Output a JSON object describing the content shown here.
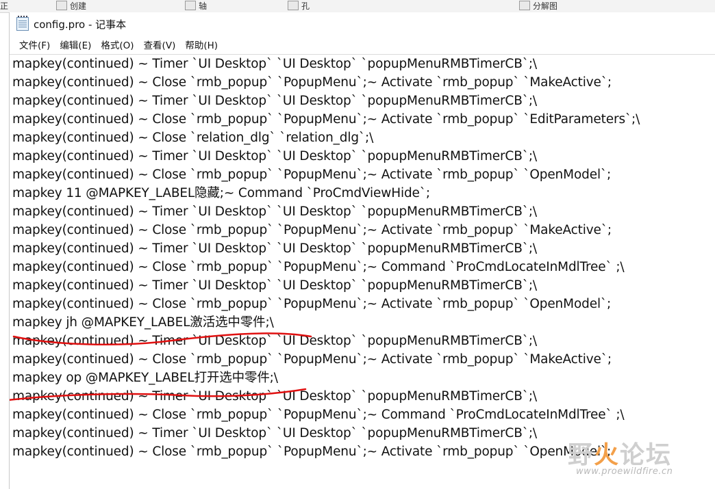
{
  "background_app": {
    "items": [
      "正",
      "创建",
      "轴",
      "孔",
      "分解图"
    ]
  },
  "window": {
    "title": "config.pro - 记事本",
    "icon": "notepad-icon"
  },
  "menu": {
    "items": [
      "文件(F)",
      "编辑(E)",
      "格式(O)",
      "查看(V)",
      "帮助(H)"
    ]
  },
  "editor": {
    "lines": [
      "mapkey(continued) ~ Timer `UI Desktop` `UI Desktop` `popupMenuRMBTimerCB`;\\",
      "mapkey(continued) ~ Close `rmb_popup` `PopupMenu`;~ Activate `rmb_popup` `MakeActive`;",
      "mapkey(continued) ~ Timer `UI Desktop` `UI Desktop` `popupMenuRMBTimerCB`;\\",
      "mapkey(continued) ~ Close `rmb_popup` `PopupMenu`;~ Activate `rmb_popup` `EditParameters`;\\",
      "mapkey(continued) ~ Close `relation_dlg` `relation_dlg`;\\",
      "mapkey(continued) ~ Timer `UI Desktop` `UI Desktop` `popupMenuRMBTimerCB`;\\",
      "mapkey(continued) ~ Close `rmb_popup` `PopupMenu`;~ Activate `rmb_popup` `OpenModel`;",
      "mapkey 11 @MAPKEY_LABEL隐藏;~ Command `ProCmdViewHide`;",
      "mapkey(continued) ~ Timer `UI Desktop` `UI Desktop` `popupMenuRMBTimerCB`;\\",
      "mapkey(continued) ~ Close `rmb_popup` `PopupMenu`;~ Activate `rmb_popup` `MakeActive`;",
      "mapkey(continued) ~ Timer `UI Desktop` `UI Desktop` `popupMenuRMBTimerCB`;\\",
      "mapkey(continued) ~ Close `rmb_popup` `PopupMenu`;~ Command `ProCmdLocateInMdlTree` ;\\",
      "mapkey(continued) ~ Timer `UI Desktop` `UI Desktop` `popupMenuRMBTimerCB`;\\",
      "mapkey(continued) ~ Close `rmb_popup` `PopupMenu`;~ Activate `rmb_popup` `OpenModel`;",
      "mapkey jh @MAPKEY_LABEL激活选中零件;\\",
      "mapkey(continued) ~ Timer `UI Desktop` `UI Desktop` `popupMenuRMBTimerCB`;\\",
      "mapkey(continued) ~ Close `rmb_popup` `PopupMenu`;~ Activate `rmb_popup` `MakeActive`;",
      "mapkey op @MAPKEY_LABEL打开选中零件;\\",
      "mapkey(continued) ~ Timer `UI Desktop` `UI Desktop` `popupMenuRMBTimerCB`;\\",
      "mapkey(continued) ~ Close `rmb_popup` `PopupMenu`;~ Command `ProCmdLocateInMdlTree` ;\\",
      "mapkey(continued) ~ Timer `UI Desktop` `UI Desktop` `popupMenuRMBTimerCB`;\\",
      "mapkey(continued) ~ Close `rmb_popup` `PopupMenu`;~ Activate `rmb_popup` `OpenModel`;"
    ]
  },
  "annotations": {
    "underline_color": "#e01010",
    "underlined_lines": [
      14,
      17
    ]
  },
  "watermark": {
    "main_prefix": "野",
    "main_accent": "火",
    "main_suffix": "论坛",
    "url": "www.proewildfire.cn"
  }
}
